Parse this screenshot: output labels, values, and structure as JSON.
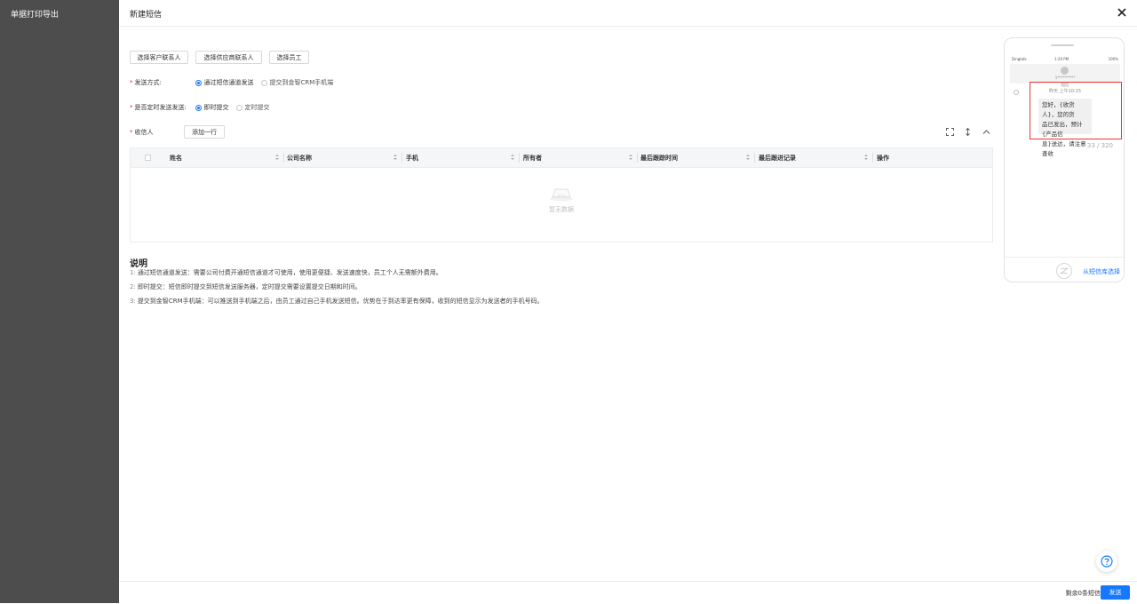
{
  "backdrop": {
    "title": "单据打印导出"
  },
  "drawer": {
    "title": "新建短信"
  },
  "toolbar": {
    "select_customer": "选择客户联系人",
    "select_supplier": "选择供应商联系人",
    "select_employee": "选择员工"
  },
  "form": {
    "send_method": {
      "label": "发送方式:",
      "options": [
        "通过短信通道发送",
        "提交到金智CRM手机端"
      ],
      "selected": "通过短信通道发送"
    },
    "scheduled": {
      "label": "是否定时发送发送:",
      "options": [
        "即时提交",
        "定时提交"
      ],
      "selected": "即时提交"
    },
    "recipients": {
      "label": "收信人",
      "add_row": "添加一行"
    }
  },
  "table": {
    "columns": [
      "姓名",
      "公司名称",
      "手机",
      "所有者",
      "最后跟踪时间",
      "最后跟进记录",
      "操作"
    ],
    "rows": [],
    "empty_text": "暂无数据"
  },
  "notes": {
    "title": "说明",
    "items": [
      {
        "num": "1:",
        "text": "通过短信通道发送：需要公司付费开通短信通道才可使用，使用更便捷、发送速度快，员工个人无需额外费用。"
      },
      {
        "num": "2:",
        "text": "即时提交：短信即时提交到短信发送服务器，定时提交需要设置提交日期和时间。"
      },
      {
        "num": "3:",
        "text": "提交到金智CRM手机端：可以推送到手机端之后，由员工通过自己手机发送短信。优势在于到达率更有保障，收到的短信显示为发送者的手机号码。"
      }
    ]
  },
  "phone": {
    "status_left": "Dingtalk",
    "status_time": "1:20 PM",
    "status_right": "100%",
    "contact_name": "1**********",
    "msg_label": "短信",
    "msg_time": "昨天 上午10:15",
    "bubble_lines": [
      "您好，{收货人}，您的货",
      "品已发出，预计{产品信",
      "息}送达，请注意查收"
    ],
    "counter": "33 / 320",
    "template_link": "从短信库选择"
  },
  "footer": {
    "remaining": "剩余0条短信",
    "send": "发送"
  },
  "colors": {
    "primary": "#1677ff",
    "highlight": "#e53935",
    "backdrop": "#4d4d4d"
  }
}
